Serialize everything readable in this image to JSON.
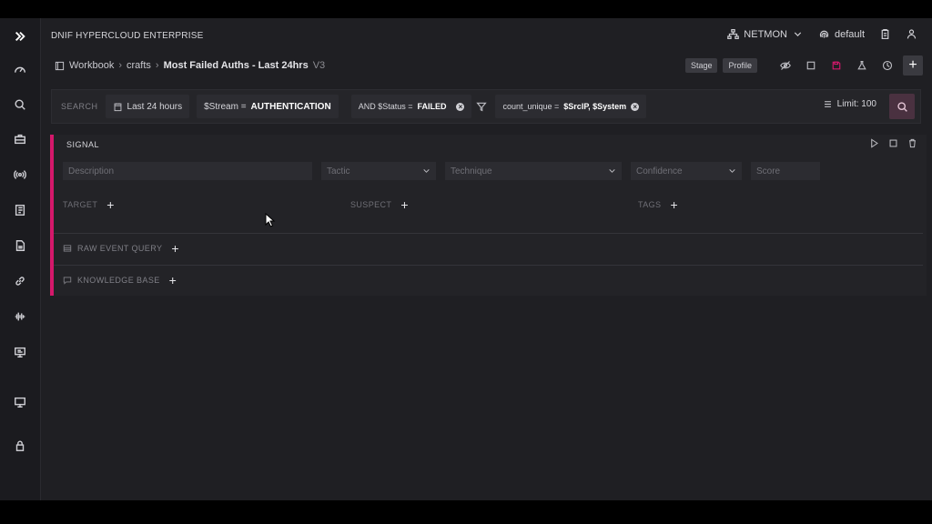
{
  "app": {
    "title": "DNIF HYPERCLOUD ENTERPRISE"
  },
  "topbar": {
    "workspace": "NETMON",
    "profile": "default"
  },
  "breadcrumb": {
    "root": "Workbook",
    "folder": "crafts",
    "name": "Most Failed Auths - Last 24hrs",
    "version": "V3"
  },
  "toolbar": {
    "stage_label": "Stage",
    "profile_label": "Profile"
  },
  "search": {
    "label": "SEARCH",
    "time_range": "Last 24 hours",
    "stream_prefix": "$Stream = ",
    "stream_value": "AUTHENTICATION",
    "filter_prefix": "AND $Status = ",
    "filter_value": "FAILED",
    "agg_prefix": "count_unique  = ",
    "agg_value": "$SrcIP, $System",
    "limit": "Limit: 100"
  },
  "signal": {
    "title": "SIGNAL",
    "description_placeholder": "Description",
    "tactic_placeholder": "Tactic",
    "technique_placeholder": "Technique",
    "confidence_placeholder": "Confidence",
    "score_placeholder": "Score",
    "target_label": "TARGET",
    "suspect_label": "SUSPECT",
    "tags_label": "TAGS",
    "raw_event_query_label": "RAW EVENT QUERY",
    "knowledge_base_label": "KNOWLEDGE BASE"
  }
}
